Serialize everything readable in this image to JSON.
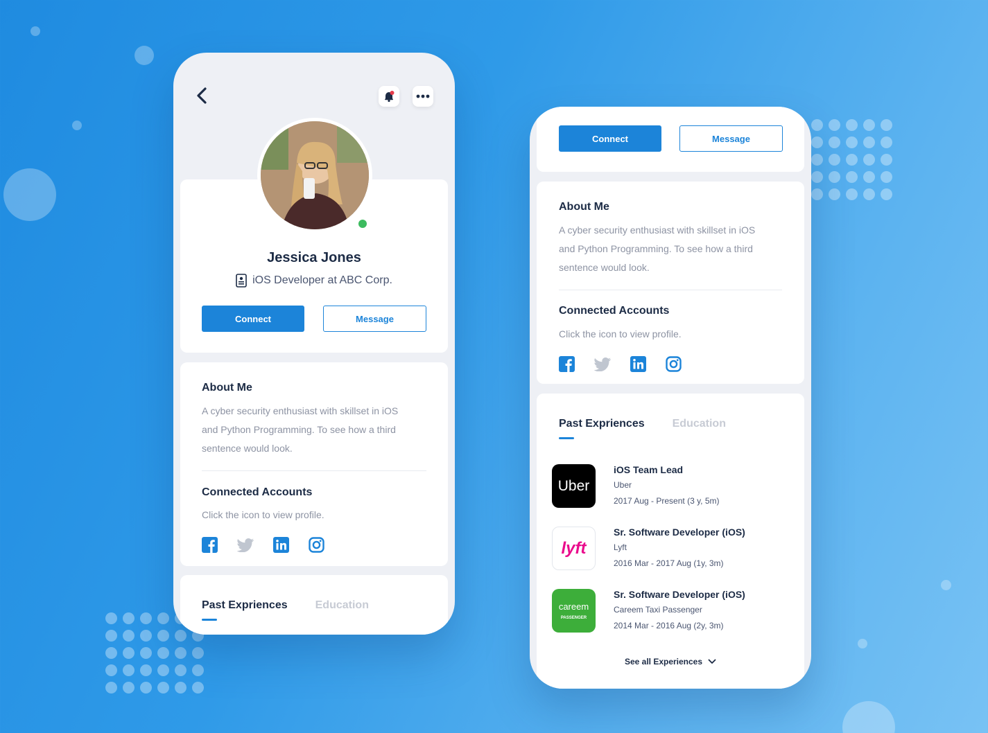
{
  "profile": {
    "name": "Jessica Jones",
    "role": "iOS Developer at ABC Corp.",
    "online": true
  },
  "actions": {
    "connect_label": "Connect",
    "message_label": "Message"
  },
  "about": {
    "heading": "About Me",
    "line1": "A cyber security enthusiast with skillset in iOS",
    "line2": "and Python Programming. To see how a third",
    "line3": "sentence would look."
  },
  "connected": {
    "heading": "Connected Accounts",
    "hint": "Click the icon to view profile.",
    "icons": [
      "facebook-icon",
      "twitter-icon",
      "linkedin-icon",
      "instagram-icon"
    ]
  },
  "tabs": {
    "experience": "Past Expriences",
    "education": "Education"
  },
  "experiences": [
    {
      "title": "iOS Team Lead",
      "company": "Uber",
      "dates": "2017 Aug - Present (3 y, 5m)",
      "logo_text": "Uber"
    },
    {
      "title": "Sr. Software Developer (iOS)",
      "company": "Lyft",
      "dates": "2016 Mar - 2017 Aug (1y, 3m)",
      "logo_text": "lyft"
    },
    {
      "title": "Sr. Software Developer (iOS)",
      "company": "Careem Taxi Passenger",
      "dates": "2014 Mar - 2016 Aug (2y, 3m)",
      "logo_text": "careem",
      "logo_subtext": "PASSENGER"
    }
  ],
  "see_all": "See all Experiences",
  "colors": {
    "accent": "#1c84d9",
    "online": "#3dbb5f",
    "uber": "#000000",
    "lyft": "#ea0b8c",
    "careem": "#3dae3a"
  }
}
